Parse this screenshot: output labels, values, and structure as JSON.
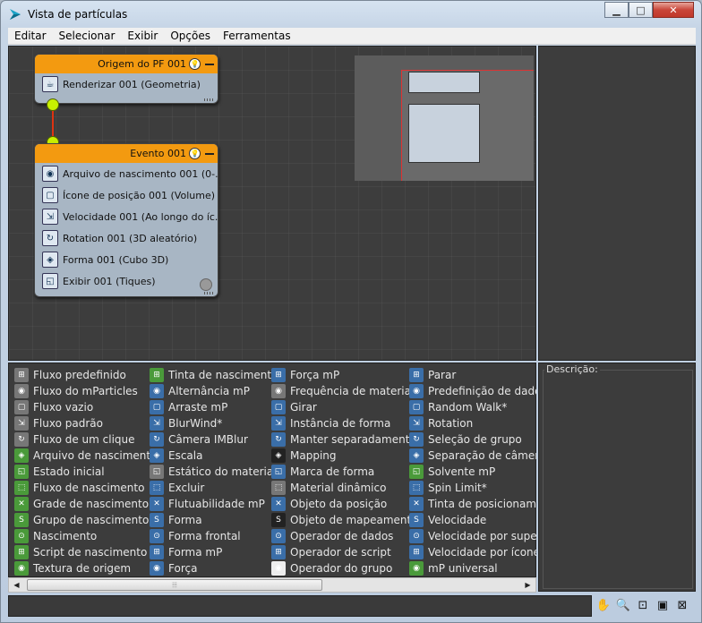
{
  "window": {
    "title": "Vista de partículas",
    "minimize": "▁",
    "maximize": "□",
    "close": "✕"
  },
  "menu": [
    "Editar",
    "Selecionar",
    "Exibir",
    "Opções",
    "Ferramentas"
  ],
  "nodes": {
    "origin": {
      "title": "Origem do PF 001",
      "ops": [
        {
          "label": "Renderizar 001 (Geometria)",
          "icon": "teapot-icon"
        }
      ]
    },
    "event": {
      "title": "Evento 001",
      "ops": [
        {
          "label": "Arquivo de nascimento 001 (0-...",
          "icon": "birth-file-icon"
        },
        {
          "label": "Ícone de posição 001 (Volume)",
          "icon": "position-icon"
        },
        {
          "label": "Velocidade 001 (Ao longo do íc...",
          "icon": "speed-icon"
        },
        {
          "label": "Rotation 001 (3D aleatório)",
          "icon": "rotation-icon"
        },
        {
          "label": "Forma 001 (Cubo 3D)",
          "icon": "shape-icon"
        },
        {
          "label": "Exibir 001 (Tiques)",
          "icon": "display-icon"
        }
      ]
    }
  },
  "depot": {
    "col1": [
      {
        "label": "Fluxo predefinido",
        "color": "#777"
      },
      {
        "label": "Fluxo do mParticles",
        "color": "#777"
      },
      {
        "label": "Fluxo vazio",
        "color": "#777"
      },
      {
        "label": "Fluxo padrão",
        "color": "#777"
      },
      {
        "label": "Fluxo de um clique",
        "color": "#777"
      },
      {
        "label": "Arquivo de nascimento",
        "color": "#4a9a3a"
      },
      {
        "label": "Estado inicial",
        "color": "#4a9a3a"
      },
      {
        "label": "Fluxo de nascimento",
        "color": "#4a9a3a"
      },
      {
        "label": "Grade de nascimento",
        "color": "#4a9a3a"
      },
      {
        "label": "Grupo de nascimento",
        "color": "#4a9a3a"
      },
      {
        "label": "Nascimento",
        "color": "#4a9a3a"
      },
      {
        "label": "Script de nascimento",
        "color": "#4a9a3a"
      },
      {
        "label": "Textura de origem",
        "color": "#4a9a3a"
      }
    ],
    "col2": [
      {
        "label": "Tinta de nascimento",
        "color": "#4a9a3a"
      },
      {
        "label": "Alternância mP",
        "color": "#3a6ea8"
      },
      {
        "label": "Arraste mP",
        "color": "#3a6ea8"
      },
      {
        "label": "BlurWind*",
        "color": "#3a6ea8"
      },
      {
        "label": "Câmera IMBlur",
        "color": "#3a6ea8"
      },
      {
        "label": "Escala",
        "color": "#3a6ea8"
      },
      {
        "label": "Estático do material",
        "color": "#777"
      },
      {
        "label": "Excluir",
        "color": "#3a6ea8"
      },
      {
        "label": "Flutuabilidade mP",
        "color": "#3a6ea8"
      },
      {
        "label": "Forma",
        "color": "#3a6ea8"
      },
      {
        "label": "Forma frontal",
        "color": "#3a6ea8"
      },
      {
        "label": "Forma mP",
        "color": "#3a6ea8"
      },
      {
        "label": "Força",
        "color": "#3a6ea8"
      }
    ],
    "col3": [
      {
        "label": "Força mP",
        "color": "#3a6ea8"
      },
      {
        "label": "Frequência de material",
        "color": "#777"
      },
      {
        "label": "Girar",
        "color": "#3a6ea8"
      },
      {
        "label": "Instância de forma",
        "color": "#3a6ea8"
      },
      {
        "label": "Manter separadamente",
        "color": "#3a6ea8"
      },
      {
        "label": "Mapping",
        "color": "#222"
      },
      {
        "label": "Marca de forma",
        "color": "#3a6ea8"
      },
      {
        "label": "Material dinâmico",
        "color": "#777"
      },
      {
        "label": "Objeto da posição",
        "color": "#3a6ea8"
      },
      {
        "label": "Objeto de mapeamento",
        "color": "#222"
      },
      {
        "label": "Operador de dados",
        "color": "#3a6ea8"
      },
      {
        "label": "Operador de script",
        "color": "#3a6ea8"
      },
      {
        "label": "Operador do grupo",
        "color": "#eee"
      }
    ],
    "col4": [
      {
        "label": "Parar",
        "color": "#3a6ea8"
      },
      {
        "label": "Predefinição de dados",
        "color": "#3a6ea8"
      },
      {
        "label": "Random Walk*",
        "color": "#3a6ea8"
      },
      {
        "label": "Rotation",
        "color": "#3a6ea8"
      },
      {
        "label": "Seleção de grupo",
        "color": "#3a6ea8"
      },
      {
        "label": "Separação de câmera",
        "color": "#3a6ea8"
      },
      {
        "label": "Solvente mP",
        "color": "#4a9a3a"
      },
      {
        "label": "Spin Limit*",
        "color": "#3a6ea8"
      },
      {
        "label": "Tinta de posicionamento",
        "color": "#3a6ea8"
      },
      {
        "label": "Velocidade",
        "color": "#3a6ea8"
      },
      {
        "label": "Velocidade por superfície",
        "color": "#3a6ea8"
      },
      {
        "label": "Velocidade por ícone",
        "color": "#3a6ea8"
      },
      {
        "label": "mP universal",
        "color": "#4a9a3a"
      }
    ]
  },
  "description": {
    "label": "Descrição:"
  },
  "scrollbar": {
    "left": "◀",
    "right": "▶",
    "grip": "⦙⦙⦙"
  },
  "tools": [
    {
      "name": "pan-icon",
      "glyph": "✋"
    },
    {
      "name": "zoom-icon",
      "glyph": "🔍"
    },
    {
      "name": "zoom-region-icon",
      "glyph": "⊡"
    },
    {
      "name": "zoom-extents-icon",
      "glyph": "▣"
    },
    {
      "name": "no-zoom-icon",
      "glyph": "⊠"
    }
  ]
}
